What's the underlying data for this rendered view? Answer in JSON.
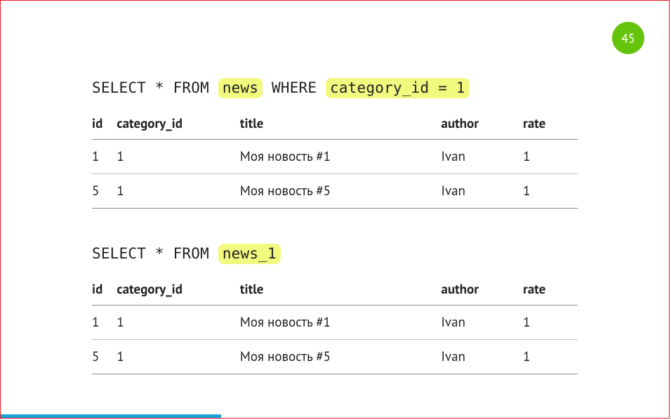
{
  "page_number": "45",
  "badge_color": "#66c30c",
  "query1": {
    "prefix": "SELECT * FROM ",
    "hl1": "news",
    "mid": " WHERE ",
    "hl2": "category_id = 1"
  },
  "query2": {
    "prefix": "SELECT * FROM ",
    "hl1": "news_1"
  },
  "columns": {
    "id": "id",
    "category_id": "category_id",
    "title": "title",
    "author": "author",
    "rate": "rate"
  },
  "table1": [
    {
      "id": "1",
      "category_id": "1",
      "title": "Моя новость #1",
      "author": "Ivan",
      "rate": "1"
    },
    {
      "id": "5",
      "category_id": "1",
      "title": "Моя новость #5",
      "author": "Ivan",
      "rate": "1"
    }
  ],
  "table2": [
    {
      "id": "1",
      "category_id": "1",
      "title": "Моя новость #1",
      "author": "Ivan",
      "rate": "1"
    },
    {
      "id": "5",
      "category_id": "1",
      "title": "Моя новость #5",
      "author": "Ivan",
      "rate": "1"
    }
  ]
}
